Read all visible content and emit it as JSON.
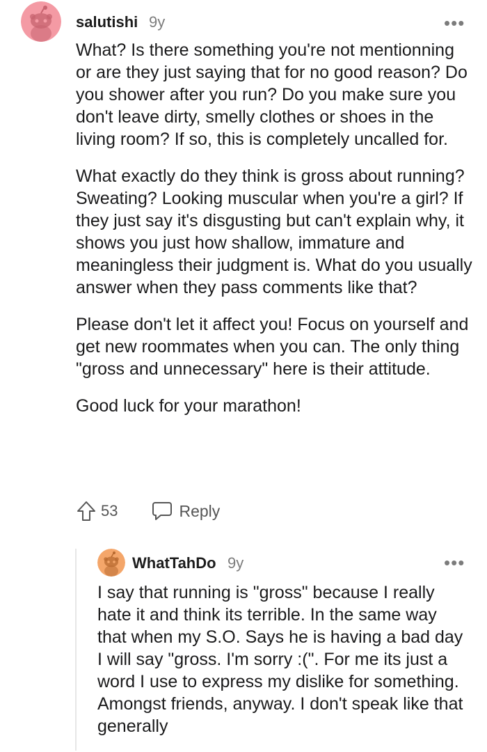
{
  "comment1": {
    "username": "salutishi",
    "age": "9y",
    "more": "•••",
    "paragraphs": [
      "What? Is there something you're not mentionning or are they just saying that for no good reason? Do you shower after you run? Do you make sure you don't leave dirty, smelly clothes or shoes in the living room? If so, this is completely uncalled for.",
      "What exactly do they think is gross about running? Sweating? Looking muscular when you're a girl? If they just say it's disgusting but can't explain why, it shows you just how shallow, immature and meaningless their judgment is. What do you usually answer when they pass comments like that?",
      "Please don't let it affect you! Focus on yourself and get new roommates when you can. The only thing \"gross and unnecessary\" here is their attitude.",
      "Good luck for your marathon!"
    ],
    "upvotes": "53",
    "reply_label": "Reply",
    "avatar_color": "#f49aa4"
  },
  "comment2": {
    "username": "WhatTahDo",
    "age": "9y",
    "more": "•••",
    "text": "I say that running is \"gross\" because I really hate it and think its terrible. In the same way that when my S.O. Says he is having a bad day I will say \"gross. I'm sorry :(\". For me its just a word I use to express my dislike for something. Amongst friends, anyway. I don't speak like that generally",
    "avatar_color": "#f4a66a"
  }
}
